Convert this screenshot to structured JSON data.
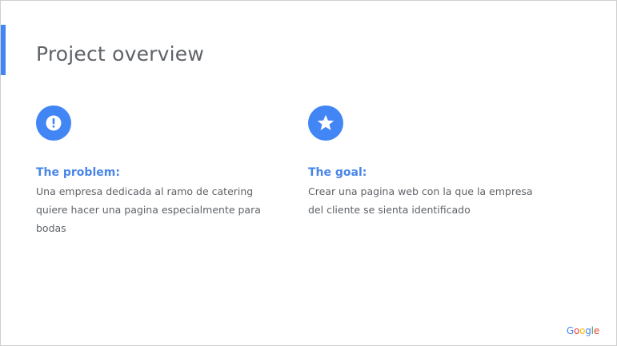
{
  "slide": {
    "title": "Project overview",
    "accent_color": "#4285f4"
  },
  "problem": {
    "icon": "exclamation-circle-icon",
    "heading": "The problem:",
    "text": "Una empresa dedicada al ramo de catering quiere hacer una pagina especialmente para bodas"
  },
  "goal": {
    "icon": "star-icon",
    "heading": "The goal:",
    "text": "Crear una pagina web con la que la empresa del cliente se sienta identificado"
  },
  "footer": {
    "logo_letters": [
      "G",
      "o",
      "o",
      "g",
      "l",
      "e"
    ],
    "logo_colors": [
      "#4285f4",
      "#ea4335",
      "#fbbc05",
      "#4285f4",
      "#34a853",
      "#ea4335"
    ]
  }
}
